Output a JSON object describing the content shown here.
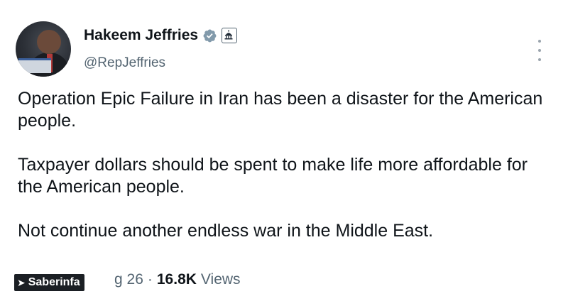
{
  "author": {
    "name": "Hakeem Jeffries",
    "handle": "@RepJeffries",
    "verified_icon": "verified-badge-icon",
    "government_icon": "capitol-building-icon"
  },
  "tweet": {
    "paragraphs": [
      "Operation Epic Failure in Iran has been a disaster for the American people.",
      "Taxpayer dollars should be spent to make life more affordable for the American people.",
      "Not continue another endless war in the Middle East."
    ]
  },
  "meta": {
    "time_partial": "g 26",
    "separator": "·",
    "views_count": "16.8K",
    "views_label": "Views"
  },
  "watermark": {
    "text": "Saberinfa"
  },
  "colors": {
    "primary_text": "#0f1419",
    "secondary_text": "#536471",
    "verified_blue": "#1d9bf0"
  }
}
